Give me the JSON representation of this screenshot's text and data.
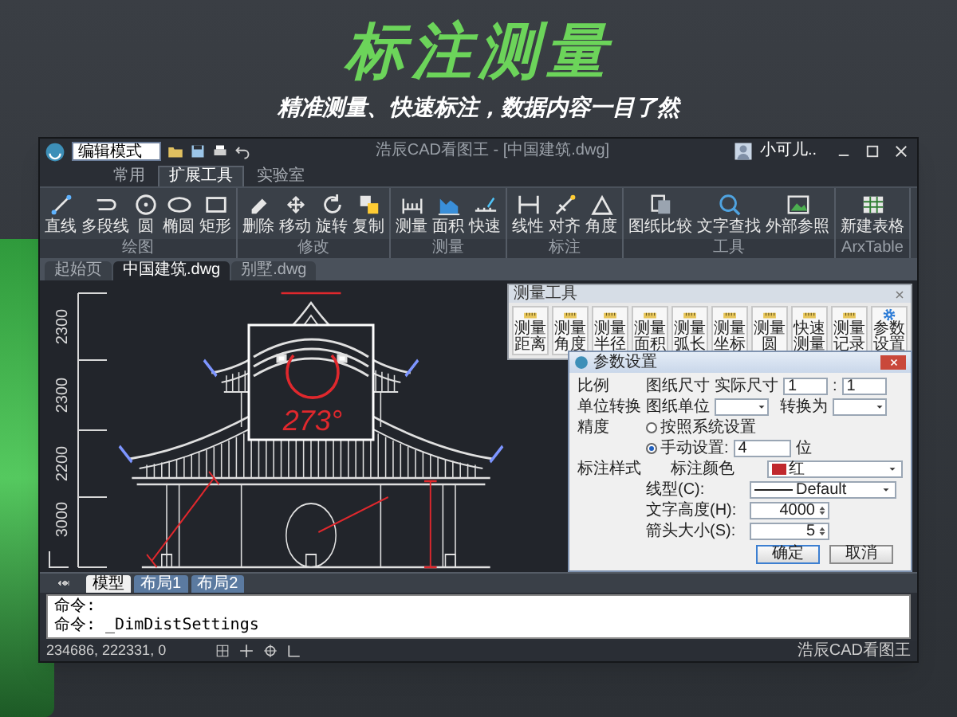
{
  "headline": "标注测量",
  "subheadline": "精准测量、快速标注，数据内容一目了然",
  "app": {
    "title_bar": {
      "mode_field": "编辑模式",
      "title": "浩辰CAD看图王 - [中国建筑.dwg]",
      "user": "小可儿.."
    },
    "ribbon_tabs": [
      {
        "label": "常用",
        "selected": false
      },
      {
        "label": "扩展工具",
        "selected": true
      },
      {
        "label": "实验室",
        "selected": false
      }
    ],
    "ribbon_groups": [
      {
        "label": "绘图",
        "buttons": [
          "直线",
          "多段线",
          "圆",
          "椭圆",
          "矩形"
        ]
      },
      {
        "label": "修改",
        "buttons": [
          "删除",
          "移动",
          "旋转",
          "复制"
        ]
      },
      {
        "label": "测量",
        "buttons": [
          "测量",
          "面积",
          "快速"
        ]
      },
      {
        "label": "标注",
        "buttons": [
          "线性",
          "对齐",
          "角度"
        ]
      },
      {
        "label": "工具",
        "buttons": [
          "图纸比较",
          "文字查找",
          "外部参照"
        ]
      },
      {
        "label": "ArxTable",
        "buttons": [
          "新建表格"
        ]
      }
    ],
    "document_tabs": [
      {
        "label": "起始页",
        "selected": false
      },
      {
        "label": "中国建筑.dwg",
        "selected": true
      },
      {
        "label": "别墅.dwg",
        "selected": false
      }
    ],
    "drawing": {
      "dimension_labels": [
        "2300",
        "2300",
        "2200",
        "3000"
      ],
      "angle_reading": "273°"
    },
    "measure_toolbar": {
      "title": "测量工具",
      "buttons": [
        "测量距离",
        "测量角度",
        "测量半径",
        "测量面积",
        "测量弧长",
        "测量坐标",
        "测量圆",
        "快速测量",
        "测量记录",
        "参数设置"
      ]
    },
    "settings_dialog": {
      "title": "参数设置",
      "scale": {
        "label": "比例",
        "drawing_size_label": "图纸尺寸",
        "actual_size_label": "实际尺寸",
        "drawing_size": "1",
        "separator": ":",
        "actual_size": "1"
      },
      "units": {
        "label": "单位转换",
        "from_label": "图纸单位",
        "to_label": "转换为"
      },
      "precision": {
        "label": "精度",
        "options": [
          {
            "label": "按照系统设置",
            "selected": false
          },
          {
            "label": "手动设置:",
            "selected": true
          }
        ],
        "digits": "4",
        "digits_unit": "位"
      },
      "style": {
        "label": "标注样式",
        "fields": [
          {
            "kind": "color",
            "label": "标注颜色",
            "value": "红",
            "color": "#c0282d"
          },
          {
            "kind": "linetype",
            "label": "线型(C):",
            "value": "Default"
          },
          {
            "kind": "spin",
            "label": "文字高度(H):",
            "value": "4000"
          },
          {
            "kind": "spin",
            "label": "箭头大小(S):",
            "value": "5"
          }
        ]
      },
      "buttons": [
        "确定",
        "取消"
      ]
    },
    "layout_tabs": [
      {
        "label": "模型",
        "selected": true
      },
      {
        "label": "布局1",
        "selected": false
      },
      {
        "label": "布局2",
        "selected": false
      }
    ],
    "command_lines": [
      "命令:",
      "命令: _DimDistSettings"
    ],
    "status_bar": {
      "coordinates": "234686, 222331, 0",
      "app_name": "浩辰CAD看图王"
    }
  }
}
